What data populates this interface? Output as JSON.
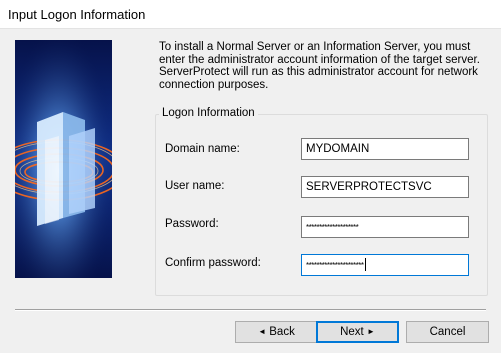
{
  "window": {
    "title": "Input Logon Information"
  },
  "intro_text": "To install a Normal Server or an Information Server, you must enter the administrator account information of the target server. ServerProtect will run as this administrator account for network connection purposes.",
  "logon_group": {
    "title": "Logon Information",
    "domain": {
      "label": "Domain name:",
      "value": "MYDOMAIN"
    },
    "user": {
      "label": "User name:",
      "value": "SERVERPROTECTSVC"
    },
    "password": {
      "label": "Password:",
      "value": "********************"
    },
    "confirm": {
      "label": "Confirm password:",
      "value": "**********************"
    }
  },
  "buttons": {
    "back": "Back",
    "next": "Next",
    "cancel": "Cancel",
    "back_arrow": "◄",
    "next_arrow": "►"
  },
  "colors": {
    "focus": "#0078d7",
    "banner_bg": "#0a1a55",
    "banner_glow": "#ff6a1a"
  }
}
